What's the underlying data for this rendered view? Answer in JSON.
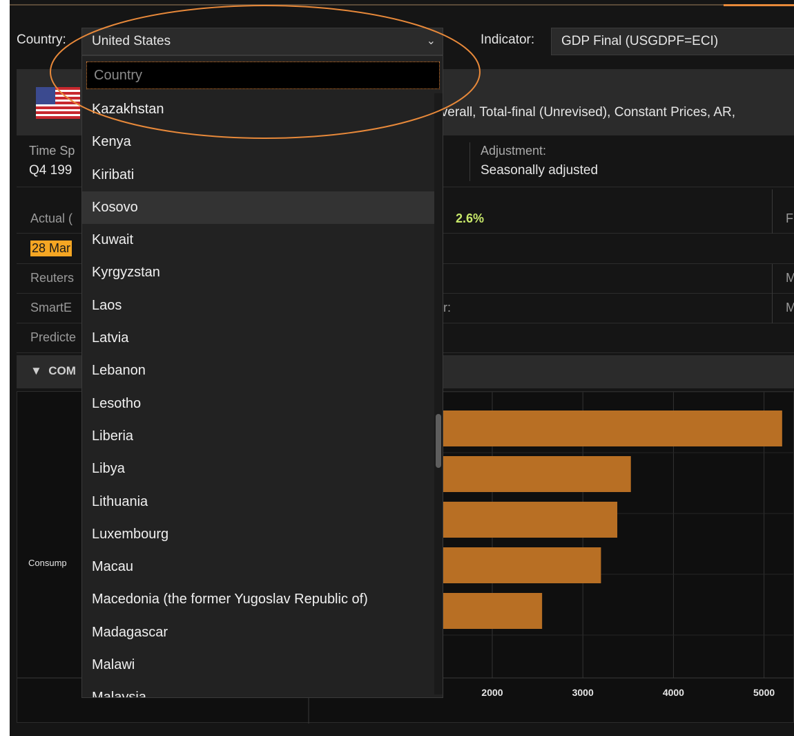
{
  "header": {
    "country_label": "Country:",
    "country_value": "United States",
    "indicator_label": "Indicator:",
    "indicator_value": "GDP Final (USGDPF=ECI)"
  },
  "info": {
    "description_visible": "Overall, Total-final (Unrevised), Constant Prices, AR,",
    "time_span_label": "Time Sp",
    "time_span_value": "Q4 199",
    "adjustment_label": "Adjustment:",
    "adjustment_value": "Seasonally adjusted"
  },
  "rows": {
    "actual_label": "Actual (",
    "actual_value": "2.6%",
    "date_badge": "28 Mar",
    "reuters_label": "Reuters",
    "smart_label": "SmartE",
    "smart_suffix": "r:",
    "predict_label": "Predicte",
    "right_f": "F",
    "right_m1": "M",
    "right_m2": "M"
  },
  "section": {
    "label": "COM"
  },
  "chart_data": {
    "type": "bar",
    "orientation": "horizontal",
    "category_visible_fragment": "Consump",
    "values": [
      5200,
      3530,
      3380,
      3200,
      2550
    ],
    "xticks": [
      2000,
      3000,
      4000,
      5000
    ],
    "xlim": [
      1000,
      5300
    ],
    "bar_color": "#b86f24",
    "grid": true
  },
  "dropdown": {
    "search_placeholder": "Country",
    "items": [
      "Kazakhstan",
      "Kenya",
      "Kiribati",
      "Kosovo",
      "Kuwait",
      "Kyrgyzstan",
      "Laos",
      "Latvia",
      "Lebanon",
      "Lesotho",
      "Liberia",
      "Libya",
      "Lithuania",
      "Luxembourg",
      "Macau",
      "Macedonia (the former Yugoslav Republic of)",
      "Madagascar",
      "Malawi",
      "Malaysia"
    ],
    "highlighted_index": 3
  },
  "colors": {
    "accent": "#e8893a",
    "positive": "#c8e86a",
    "badge": "#f5a623",
    "bar": "#b86f24"
  }
}
